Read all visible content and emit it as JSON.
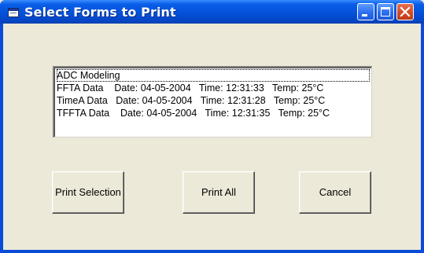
{
  "window": {
    "title": "Select Forms to Print",
    "icon": "app-window-icon",
    "controls": [
      "minimize-icon",
      "maximize-icon",
      "close-icon"
    ]
  },
  "list": {
    "items": [
      "ADC Modeling",
      "FFTA Data    Date: 04-05-2004   Time: 12:31:33   Temp: 25°C",
      "TimeA Data   Date: 04-05-2004   Time: 12:31:28   Temp: 25°C",
      "TFFTA Data    Date: 04-05-2004   Time: 12:31:35   Temp: 25°C"
    ],
    "selected_index": 0
  },
  "buttons": {
    "print_selection": "Print Selection",
    "print_all": "Print All",
    "cancel": "Cancel"
  },
  "colors": {
    "titlebar": "#0453DC",
    "client_bg": "#ECE9D8",
    "close_button": "#D24A24"
  }
}
